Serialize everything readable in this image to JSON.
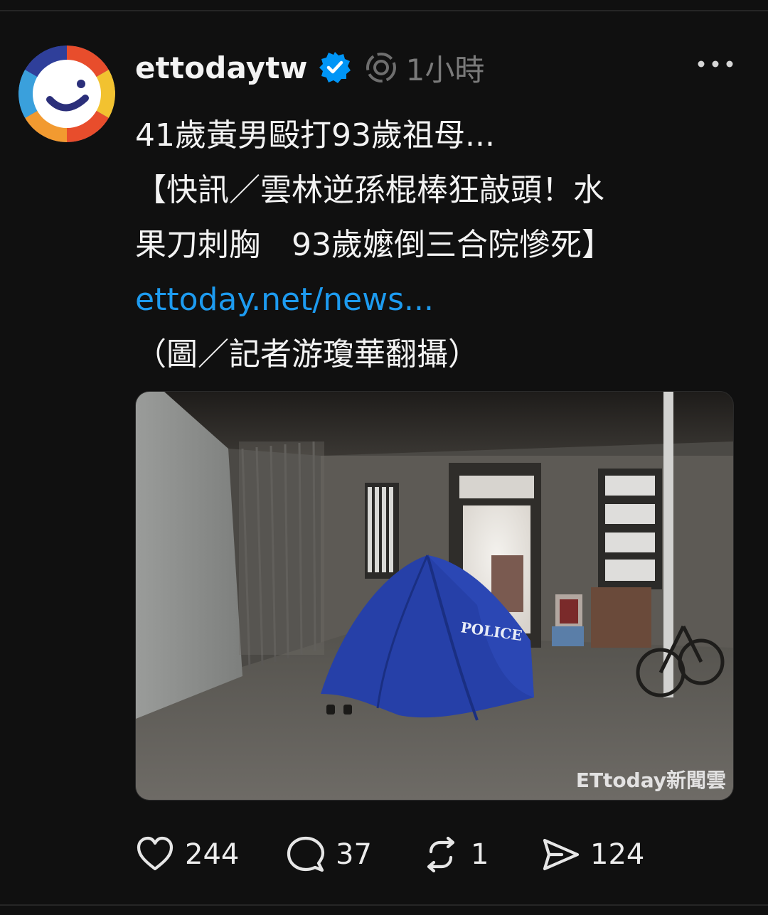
{
  "post": {
    "username": "ettodaytw",
    "timestamp": "1小時",
    "text_lines": [
      "41歲黃男毆打93歲祖母...",
      "【快訊／雲林逆孫棍棒狂敲頭！水",
      "果刀刺胸　93歲嬤倒三合院慘死】"
    ],
    "link_text": "ettoday.net/news...",
    "caption": "（圖／記者游瓊華翻攝）",
    "image": {
      "tent_text": "POLICE",
      "watermark": "ETtoday新聞雲"
    }
  },
  "actions": {
    "likes": "244",
    "replies": "37",
    "reposts": "1",
    "shares": "124"
  },
  "icons": {
    "avatar": "ettoday-logo",
    "verified": "verified-badge-icon",
    "ai": "ai-info-icon",
    "more": "more-icon",
    "like": "heart-icon",
    "reply": "comment-icon",
    "repost": "repost-icon",
    "share": "send-icon"
  },
  "colors": {
    "background": "#101010",
    "link": "#1d9bf0",
    "verified": "#0095f6",
    "muted": "#7a7a7a"
  }
}
